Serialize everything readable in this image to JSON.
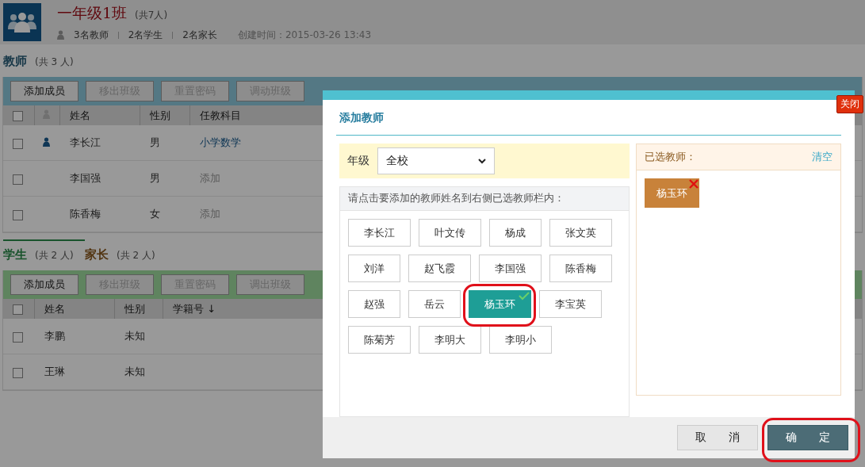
{
  "header": {
    "title": "一年级1班",
    "count": "(共7人)",
    "stats": [
      "3名教师",
      "2名学生",
      "2名家长"
    ],
    "created": "创建时间：2015-03-26 13:43"
  },
  "teachers": {
    "title": "教师",
    "count": "(共 3 人)",
    "toolbar": [
      {
        "label": "添加成员",
        "disabled": false
      },
      {
        "label": "移出班级",
        "disabled": true
      },
      {
        "label": "重置密码",
        "disabled": true
      },
      {
        "label": "调动班级",
        "disabled": true
      }
    ],
    "select_all_checked": false,
    "columns": [
      "姓名",
      "性别",
      "任教科目"
    ],
    "rows": [
      {
        "checked": false,
        "head_teacher": true,
        "name": "李长江",
        "gender": "男",
        "subject": "小学数学",
        "subject_is_link": true
      },
      {
        "checked": false,
        "head_teacher": false,
        "name": "李国强",
        "gender": "男",
        "subject": "添加",
        "subject_is_link": false
      },
      {
        "checked": false,
        "head_teacher": false,
        "name": "陈香梅",
        "gender": "女",
        "subject": "添加",
        "subject_is_link": false
      }
    ]
  },
  "tabs": [
    {
      "label": "学生",
      "count": "(共 2 人)",
      "selected": true
    },
    {
      "label": "家长",
      "count": "(共 2 人)",
      "selected": false
    }
  ],
  "students": {
    "toolbar": [
      {
        "label": "添加成员",
        "disabled": false
      },
      {
        "label": "移出班级",
        "disabled": true
      },
      {
        "label": "重置密码",
        "disabled": true
      },
      {
        "label": "调出班级",
        "disabled": true
      }
    ],
    "select_all_checked": false,
    "columns": [
      "姓名",
      "性别",
      "学籍号 ↓"
    ],
    "rows": [
      {
        "checked": false,
        "name": "李鹏",
        "gender": "未知"
      },
      {
        "checked": false,
        "name": "王琳",
        "gender": "未知"
      }
    ]
  },
  "modal": {
    "title": "添加教师",
    "close": "关闭",
    "grade_label": "年级",
    "grade_value": "全校",
    "hint": "请点击要添加的教师姓名到右侧已选教师栏内：",
    "teachers": [
      {
        "name": "李长江",
        "selected": false
      },
      {
        "name": "叶文传",
        "selected": false
      },
      {
        "name": "杨成",
        "selected": false
      },
      {
        "name": "张文英",
        "selected": false
      },
      {
        "name": "刘洋",
        "selected": false
      },
      {
        "name": "赵飞霞",
        "selected": false
      },
      {
        "name": "李国强",
        "selected": false
      },
      {
        "name": "陈香梅",
        "selected": false
      },
      {
        "name": "赵强",
        "selected": false
      },
      {
        "name": "岳云",
        "selected": false
      },
      {
        "name": "杨玉环",
        "selected": true
      },
      {
        "name": "李宝英",
        "selected": false
      },
      {
        "name": "陈菊芳",
        "selected": false
      },
      {
        "name": "李明大",
        "selected": false
      },
      {
        "name": "李明小",
        "selected": false
      }
    ],
    "selected_title": "已选教师：",
    "clear": "清空",
    "selected_list": [
      "杨玉环"
    ],
    "cancel": "取　　消",
    "confirm": "确　　定"
  }
}
